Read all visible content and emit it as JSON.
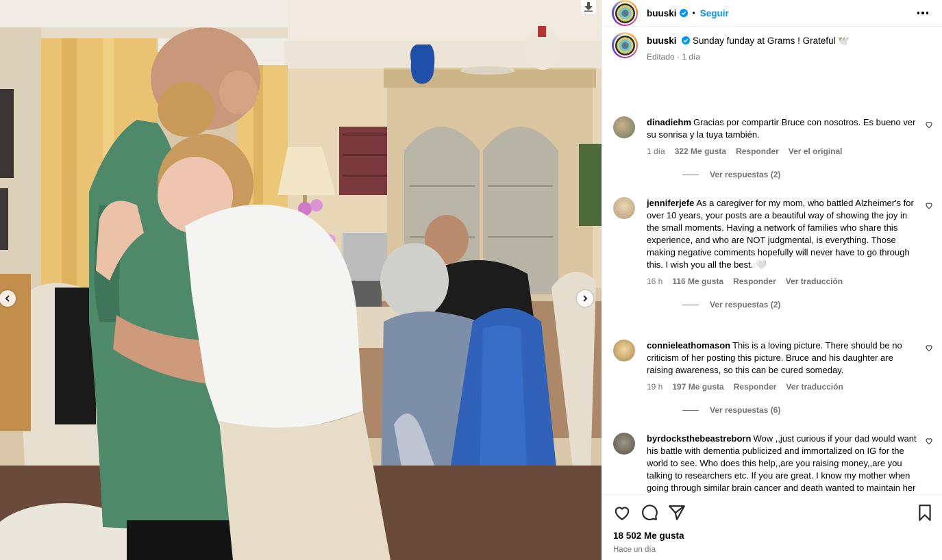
{
  "post": {
    "username": "buuski",
    "follow_label": "Seguir",
    "caption": "Sunday funday at Grams ! Grateful 🕊️",
    "caption_meta": "Editado · 1 día",
    "likes": "18 502 Me gusta",
    "posted": "Hace un día"
  },
  "comments": [
    {
      "user": "dinadiehm",
      "text": "Gracias por compartir Bruce con nosotros. Es bueno ver su sonrisa y la tuya también.",
      "time": "1 día",
      "likes": "322 Me gusta",
      "reply": "Responder",
      "translate": "Ver el original",
      "replies": "Ver respuestas (2)"
    },
    {
      "user": "jenniferjefe",
      "text": "As a caregiver for my mom, who battled Alzheimer's for over 10 years, your posts are a beautiful way of showing the joy in the small moments. Having a network of families who share this experience, and who are NOT judgmental, is everything. Those making negative comments hopefully will never have to go through this. I wish you all the best. 🤍",
      "time": "16 h",
      "likes": "116 Me gusta",
      "reply": "Responder",
      "translate": "Ver traducción",
      "replies": "Ver respuestas (2)"
    },
    {
      "user": "connieleathomason",
      "text": "This is a loving picture. There should be no criticism of her posting this picture. Bruce and his daughter are raising awareness, so this can be cured someday.",
      "time": "19 h",
      "likes": "197 Me gusta",
      "reply": "Responder",
      "translate": "Ver traducción",
      "replies": "Ver respuestas (6)"
    },
    {
      "user": "byrdocksthebeastreborn",
      "text": "Wow ,,just curious if your dad would want his battle with dementia publicized and immortalized on IG for the world to see. Who does this help,,are you raising money,,are you talking to researchers etc. If you are great. I know my mother when going through similar brain cancer and death wanted to maintain her privacy and dignity. Not being remembered like a prop while I sit on the floor and have my pic taken with my adult legs. Respect."
    }
  ],
  "icons": {
    "verified": "verified-badge-icon",
    "like": "heart-icon",
    "comment": "comment-icon",
    "share": "paper-plane-icon",
    "save": "bookmark-icon",
    "more": "more-dots-icon",
    "prev": "chevron-left-icon",
    "next": "chevron-right-icon",
    "download": "download-arrow-icon"
  },
  "colors": {
    "link_blue": "#0095f6",
    "muted_gray": "#737373",
    "verified_blue": "#0095f6"
  }
}
